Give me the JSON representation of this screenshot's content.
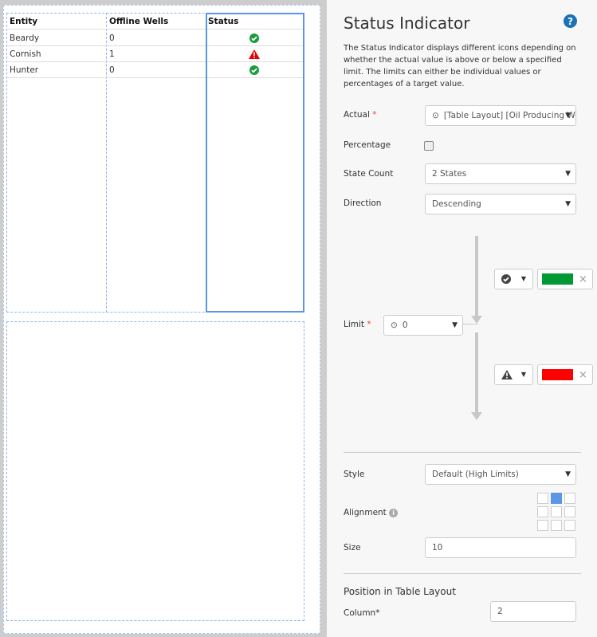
{
  "table": {
    "headers": [
      "Entity",
      "Offline Wells",
      "Status"
    ],
    "rows": [
      {
        "entity": "Beardy",
        "offline": "0",
        "status": "ok"
      },
      {
        "entity": "Cornish",
        "offline": "1",
        "status": "warning"
      },
      {
        "entity": "Hunter",
        "offline": "0",
        "status": "ok"
      }
    ]
  },
  "panel": {
    "title": "Status Indicator",
    "description": "The Status Indicator displays different icons depending on whether the actual value is above or below a specified limit. The limits can either be individual values or percentages of a target value.",
    "actual_label": "Actual",
    "required_mark": "*",
    "actual_value": "[Table Layout] [Oil Producing Wells]",
    "percentage_label": "Percentage",
    "percentage_checked": false,
    "state_count_label": "State Count",
    "state_count_value": "2 States",
    "direction_label": "Direction",
    "direction_value": "Descending",
    "limit_label": "Limit",
    "limit_value": "0",
    "states": [
      {
        "icon": "check-circle",
        "color": "#009933"
      },
      {
        "icon": "warning",
        "color": "#ff0000"
      }
    ],
    "style_label": "Style",
    "style_value": "Default (High Limits)",
    "alignment_label": "Alignment",
    "alignment_selected": "top-center",
    "size_label": "Size",
    "size_value": "10",
    "position_title": "Position in Table Layout",
    "column_label": "Column*",
    "column_value": "2"
  },
  "colors": {
    "ok": "#1a9c3e",
    "warning": "#e60000",
    "accent": "#5b96e6",
    "help": "#1a73b8"
  }
}
